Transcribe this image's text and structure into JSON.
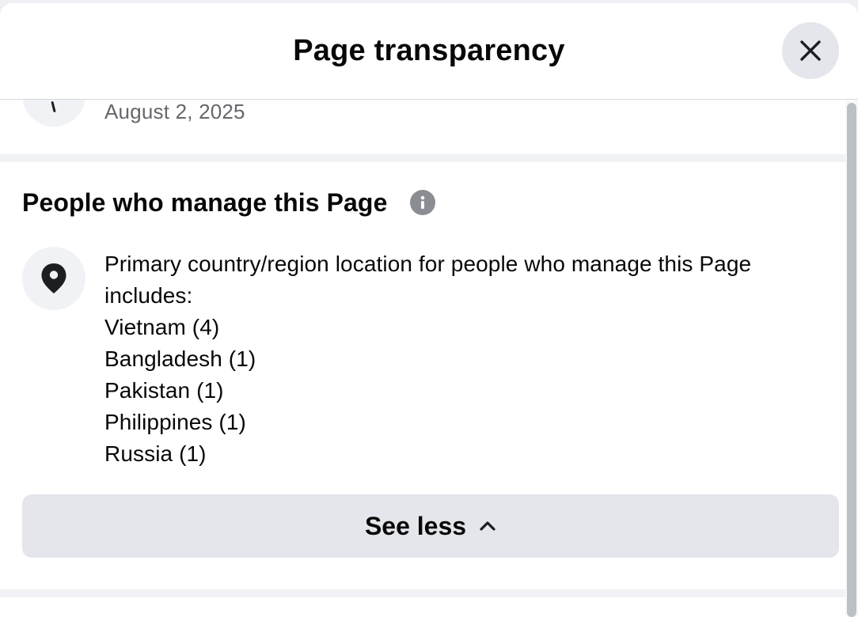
{
  "dialog": {
    "title": "Page transparency",
    "close_icon": "close-icon"
  },
  "history": {
    "date": "August 2, 2025"
  },
  "managers": {
    "title": "People who manage this Page",
    "info_icon": "info-icon",
    "location_icon": "location-pin-icon",
    "description": "Primary country/region location for people who manage this Page includes:",
    "countries": [
      "Vietnam (4)",
      "Bangladesh (1)",
      "Pakistan (1)",
      "Philippines (1)",
      "Russia (1)"
    ],
    "toggle_label": "See less",
    "toggle_icon": "chevron-up-icon"
  },
  "colors": {
    "text_primary": "#080809",
    "text_secondary": "#65676b",
    "button_bg": "#e4e6eb",
    "icon_bg": "#f0f2f5",
    "info_icon": "#8a8d91"
  }
}
